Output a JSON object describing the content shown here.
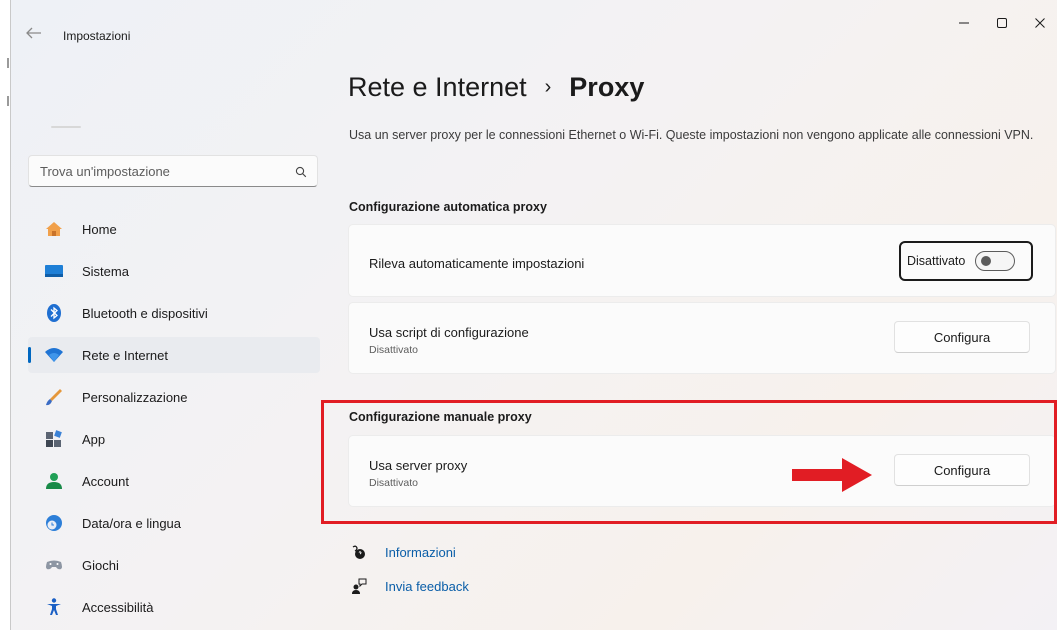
{
  "window": {
    "title": "Impostazioni"
  },
  "search": {
    "placeholder": "Trova un'impostazione"
  },
  "sidebar": {
    "items": [
      {
        "label": "Home",
        "icon": "home-icon"
      },
      {
        "label": "Sistema",
        "icon": "monitor-icon"
      },
      {
        "label": "Bluetooth e dispositivi",
        "icon": "bluetooth-icon"
      },
      {
        "label": "Rete e Internet",
        "icon": "wifi-icon",
        "active": true
      },
      {
        "label": "Personalizzazione",
        "icon": "brush-icon"
      },
      {
        "label": "App",
        "icon": "apps-icon"
      },
      {
        "label": "Account",
        "icon": "account-icon"
      },
      {
        "label": "Data/ora e lingua",
        "icon": "clock-globe-icon"
      },
      {
        "label": "Giochi",
        "icon": "gamepad-icon"
      },
      {
        "label": "Accessibilità",
        "icon": "accessibility-icon"
      }
    ]
  },
  "breadcrumb": {
    "parent": "Rete e Internet",
    "separator": "›",
    "current": "Proxy"
  },
  "description": "Usa un server proxy per le connessioni Ethernet o Wi-Fi. Queste impostazioni non vengono applicate alle connessioni VPN.",
  "auto_section": {
    "title": "Configurazione automatica proxy",
    "detect": {
      "label": "Rileva automaticamente impostazioni",
      "toggle_label": "Disattivato",
      "toggle_on": false
    },
    "script": {
      "label": "Usa script di configurazione",
      "status": "Disattivato",
      "button": "Configura"
    }
  },
  "manual_section": {
    "title": "Configurazione manuale proxy",
    "proxy": {
      "label": "Usa server proxy",
      "status": "Disattivato",
      "button": "Configura"
    }
  },
  "links": [
    {
      "label": "Informazioni",
      "icon": "help-icon"
    },
    {
      "label": "Invia feedback",
      "icon": "feedback-icon"
    }
  ],
  "colors": {
    "accent": "#0067c0",
    "highlight": "#e11d24",
    "link": "#0a5ea8"
  }
}
